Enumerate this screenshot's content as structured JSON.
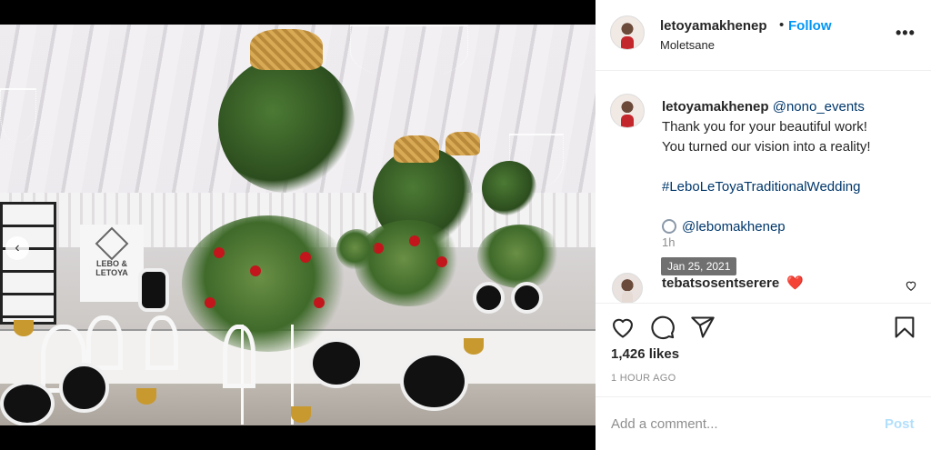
{
  "header": {
    "username": "letoyamakhenep",
    "separator": "•",
    "follow_label": "Follow",
    "location": "Moletsane",
    "more_label": "•••"
  },
  "photo": {
    "board_text": "LEBO & LETOYA",
    "prev_arrow": "‹"
  },
  "caption": {
    "username": "letoyamakhenep",
    "mention": "@nono_events",
    "line1": "Thank you for your beautiful work!",
    "line2": "You turned our vision into a reality!",
    "hashtag": "#LeboLeToyaTraditionalWedding",
    "ring_mention": "@lebomakhenep",
    "time": "1h",
    "tooltip_date": "Jan 25, 2021"
  },
  "comment": {
    "username": "tebatsosentserere",
    "emoji": "❤️"
  },
  "actions": {
    "likes": "1,426 likes",
    "posted_ago": "1 HOUR AGO"
  },
  "composer": {
    "placeholder": "Add a comment...",
    "post_label": "Post"
  },
  "icons": [
    "heart-icon",
    "comment-icon",
    "share-icon",
    "bookmark-icon",
    "options-icon",
    "like-comment-icon",
    "ring-icon"
  ],
  "colors": {
    "accent": "#0095f6",
    "link": "#00376b",
    "post_disabled": "#b2dffc",
    "muted": "#8e8e8e",
    "text": "#262626"
  }
}
